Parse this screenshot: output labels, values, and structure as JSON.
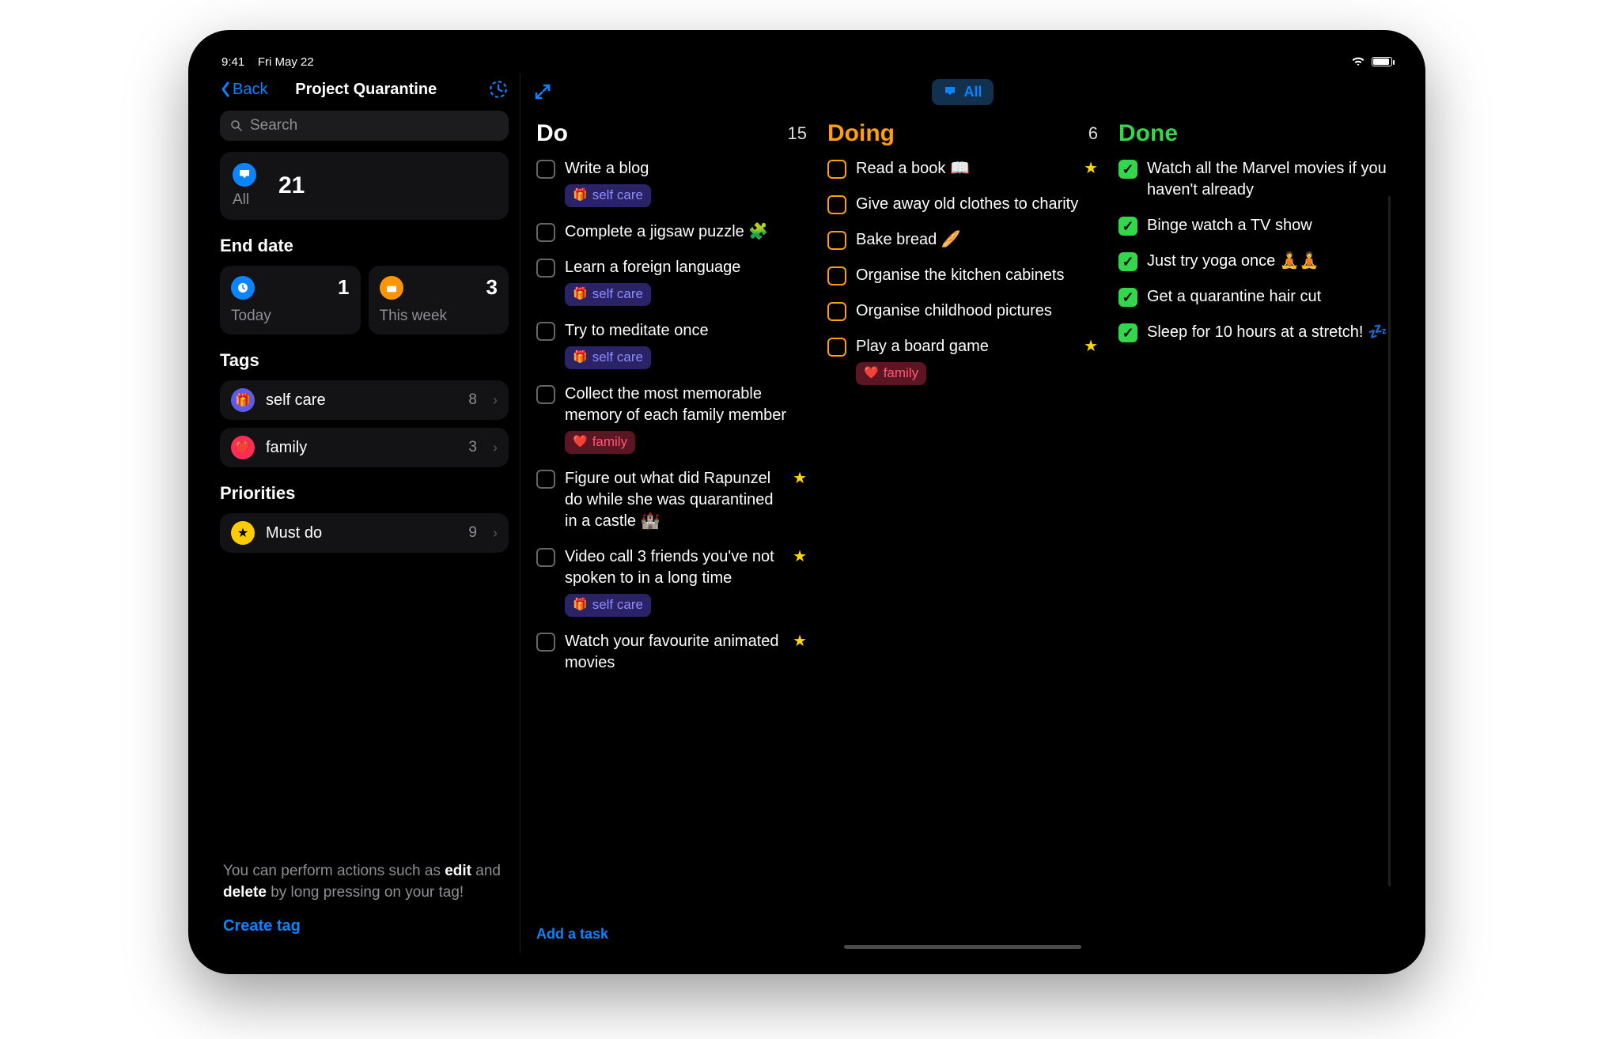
{
  "status": {
    "time": "9:41",
    "date": "Fri May 22"
  },
  "nav": {
    "back": "Back",
    "title": "Project Quarantine"
  },
  "search": {
    "placeholder": "Search"
  },
  "all": {
    "label": "All",
    "count": "21"
  },
  "endDate": {
    "heading": "End date",
    "today": {
      "label": "Today",
      "count": "1"
    },
    "week": {
      "label": "This week",
      "count": "3"
    }
  },
  "tags": {
    "heading": "Tags",
    "items": [
      {
        "icon": "🎁",
        "label": "self care",
        "count": "8"
      },
      {
        "icon": "❤️",
        "label": "family",
        "count": "3"
      }
    ]
  },
  "priorities": {
    "heading": "Priorities",
    "items": [
      {
        "icon": "★",
        "label": "Must do",
        "count": "9"
      }
    ]
  },
  "hint": {
    "pre": "You can perform actions such as ",
    "b1": "edit",
    "mid": " and ",
    "b2": "delete",
    "post": " by long pressing on your tag!"
  },
  "createTag": "Create tag",
  "filter": {
    "label": "All"
  },
  "addTask": "Add a task",
  "columns": {
    "do": {
      "title": "Do",
      "count": "15"
    },
    "doing": {
      "title": "Doing",
      "count": "6"
    },
    "done": {
      "title": "Done"
    }
  },
  "tasks": {
    "do": [
      {
        "text": "Write a blog",
        "tag": "selfcare"
      },
      {
        "text": "Complete a jigsaw puzzle 🧩"
      },
      {
        "text": "Learn a foreign language",
        "tag": "selfcare"
      },
      {
        "text": "Try to meditate once",
        "tag": "selfcare"
      },
      {
        "text": "Collect the most memorable memory of each family member",
        "tag": "family"
      },
      {
        "text": "Figure out what did Rapunzel do while she was quarantined in a castle 🏰",
        "star": true
      },
      {
        "text": "Video call 3 friends you've not spoken to in a long time",
        "tag": "selfcare",
        "star": true
      },
      {
        "text": "Watch your favourite animated movies",
        "star": true
      }
    ],
    "doing": [
      {
        "text": "Read a book 📖",
        "star": true
      },
      {
        "text": "Give away old clothes to charity"
      },
      {
        "text": "Bake bread 🥖"
      },
      {
        "text": "Organise the kitchen cabinets"
      },
      {
        "text": "Organise childhood pictures"
      },
      {
        "text": "Play a board game",
        "tag": "family",
        "star": true
      }
    ],
    "done": [
      {
        "text": "Watch all the Marvel movies if you haven't already"
      },
      {
        "text": "Binge watch a TV show"
      },
      {
        "text": "Just try yoga once 🧘🧘"
      },
      {
        "text": "Get a quarantine hair cut"
      },
      {
        "text": "Sleep for 10 hours at a stretch! 💤"
      }
    ]
  },
  "chipLabels": {
    "selfcare": "self care",
    "family": "family"
  },
  "chipIcons": {
    "selfcare": "🎁",
    "family": "❤️"
  }
}
